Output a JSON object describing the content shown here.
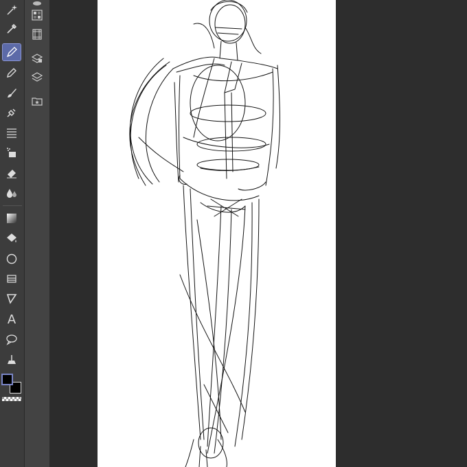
{
  "toolbar": {
    "tools": [
      {
        "icon": "sparkle-magic-wand-icon"
      },
      {
        "icon": "eyedropper-icon"
      },
      {
        "icon": "pen-icon",
        "selected": true
      },
      {
        "icon": "pencil-icon"
      },
      {
        "icon": "brush-icon"
      },
      {
        "icon": "airbrush-icon"
      },
      {
        "icon": "decoration-lines-icon"
      },
      {
        "icon": "fill-bucket-spray-icon"
      },
      {
        "icon": "eraser-icon"
      },
      {
        "icon": "blend-drops-icon"
      },
      {
        "icon": "gradient-icon"
      },
      {
        "icon": "fill-icon"
      },
      {
        "icon": "ellipse-shape-icon"
      },
      {
        "icon": "frame-border-icon"
      },
      {
        "icon": "ruler-icon"
      },
      {
        "icon": "text-tool-icon",
        "glyph": "A"
      },
      {
        "icon": "balloon-icon"
      },
      {
        "icon": "correct-line-icon"
      }
    ],
    "colors": {
      "main": "#000000",
      "sub": "#000000",
      "accent": "#5c6aa8"
    }
  },
  "subpanel": {
    "items": [
      {
        "icon": "material-grid-icon"
      },
      {
        "icon": "filmstrip-icon"
      },
      {
        "icon": "layer-property-icon"
      },
      {
        "icon": "layers-icon"
      },
      {
        "icon": "folder-star-icon"
      }
    ]
  },
  "canvas": {
    "background": "#ffffff",
    "content": "fashion-figure-sketch"
  }
}
